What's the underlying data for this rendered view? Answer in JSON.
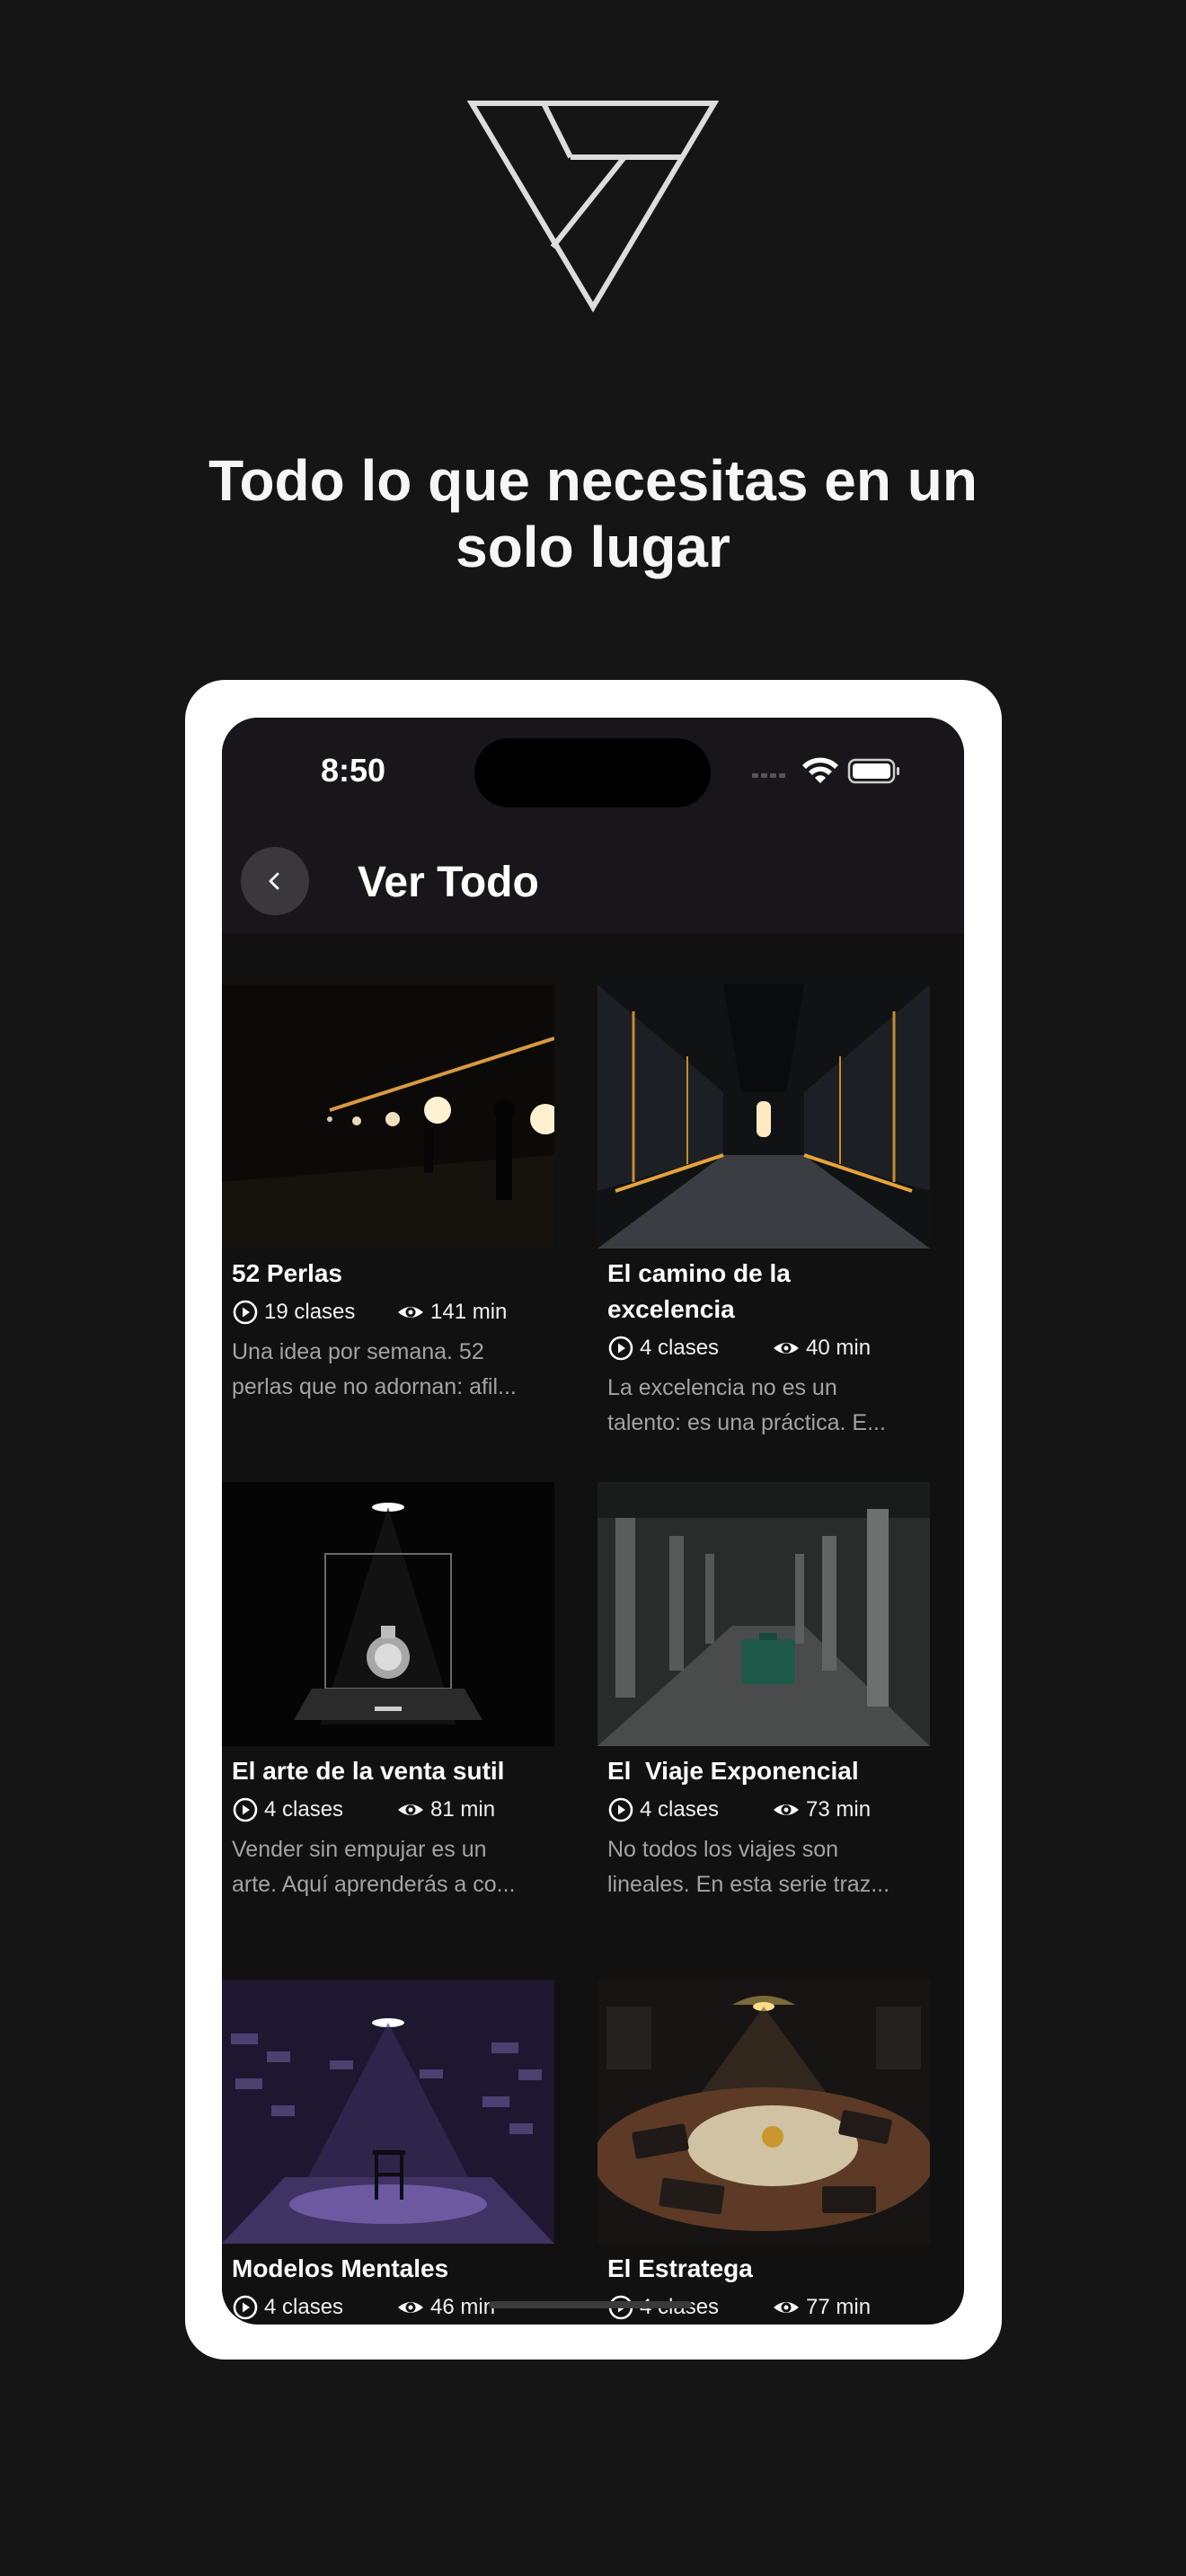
{
  "headline": {
    "line1": "Todo lo que necesitas en un",
    "line2": "solo lugar"
  },
  "status": {
    "time": "8:50"
  },
  "nav": {
    "title": "Ver Todo"
  },
  "cards": [
    {
      "title_lines": [
        "52 Perlas"
      ],
      "lessons": "19 clases",
      "duration": "141 min",
      "desc": [
        "Una idea por semana. 52",
        "perlas que no adornan: afil..."
      ]
    },
    {
      "title_lines": [
        "El camino de la",
        "excelencia"
      ],
      "lessons": "4 clases",
      "duration": "40 min",
      "desc": [
        "La excelencia no es un",
        "talento: es una práctica. E..."
      ]
    },
    {
      "title_lines": [
        "El arte de la venta sutil"
      ],
      "lessons": "4 clases",
      "duration": "81 min",
      "desc": [
        "Vender sin empujar es un",
        "arte. Aquí aprenderás a co..."
      ]
    },
    {
      "title_lines": [
        "El  Viaje Exponencial"
      ],
      "lessons": "4 clases",
      "duration": "73 min",
      "desc": [
        "No todos los viajes son",
        "lineales. En esta serie traz..."
      ]
    },
    {
      "title_lines": [
        "Modelos Mentales"
      ],
      "lessons": "4 clases",
      "duration": "46 min",
      "desc": []
    },
    {
      "title_lines": [
        "El Estratega"
      ],
      "lessons": "4 clases",
      "duration": "77 min",
      "desc": []
    }
  ],
  "icons": {
    "logo": "triangle-logo-icon",
    "back": "chevron-left-icon",
    "lessons": "play-circle-icon",
    "duration": "eye-icon",
    "wifi": "wifi-icon",
    "battery": "battery-icon",
    "signal": "signal-icon"
  },
  "colors": {
    "background": "#151515",
    "frame": "#ffffff",
    "navbar": "#19161b",
    "screen": "#111111",
    "muted_text": "#a3a3a3"
  }
}
